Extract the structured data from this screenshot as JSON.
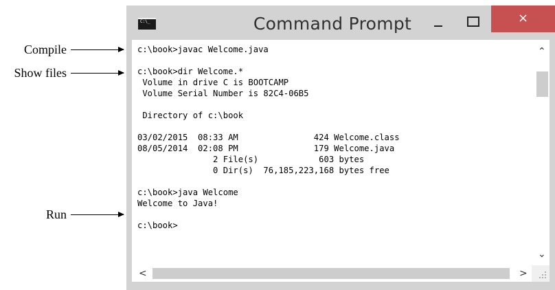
{
  "annotations": [
    {
      "label": "Compile"
    },
    {
      "label": "Show files"
    },
    {
      "label": "Run"
    }
  ],
  "window": {
    "title": "Command Prompt",
    "icon_text": "C:\\_",
    "controls": {
      "minimize": "–",
      "maximize": "□",
      "close": "×"
    }
  },
  "console": {
    "lines": [
      "c:\\book>javac Welcome.java",
      "",
      "c:\\book>dir Welcome.*",
      " Volume in drive C is BOOTCAMP",
      " Volume Serial Number is 82C4-06B5",
      "",
      " Directory of c:\\book",
      "",
      "03/02/2015  08:33 AM               424 Welcome.class",
      "08/05/2014  02:08 PM               179 Welcome.java",
      "               2 File(s)            603 bytes",
      "               0 Dir(s)  76,185,223,168 bytes free",
      "",
      "c:\\book>java Welcome",
      "Welcome to Java!",
      "",
      "c:\\book>"
    ]
  },
  "scrollbars": {
    "up": "⌃",
    "down": "⌄",
    "left": "<",
    "right": ">"
  }
}
